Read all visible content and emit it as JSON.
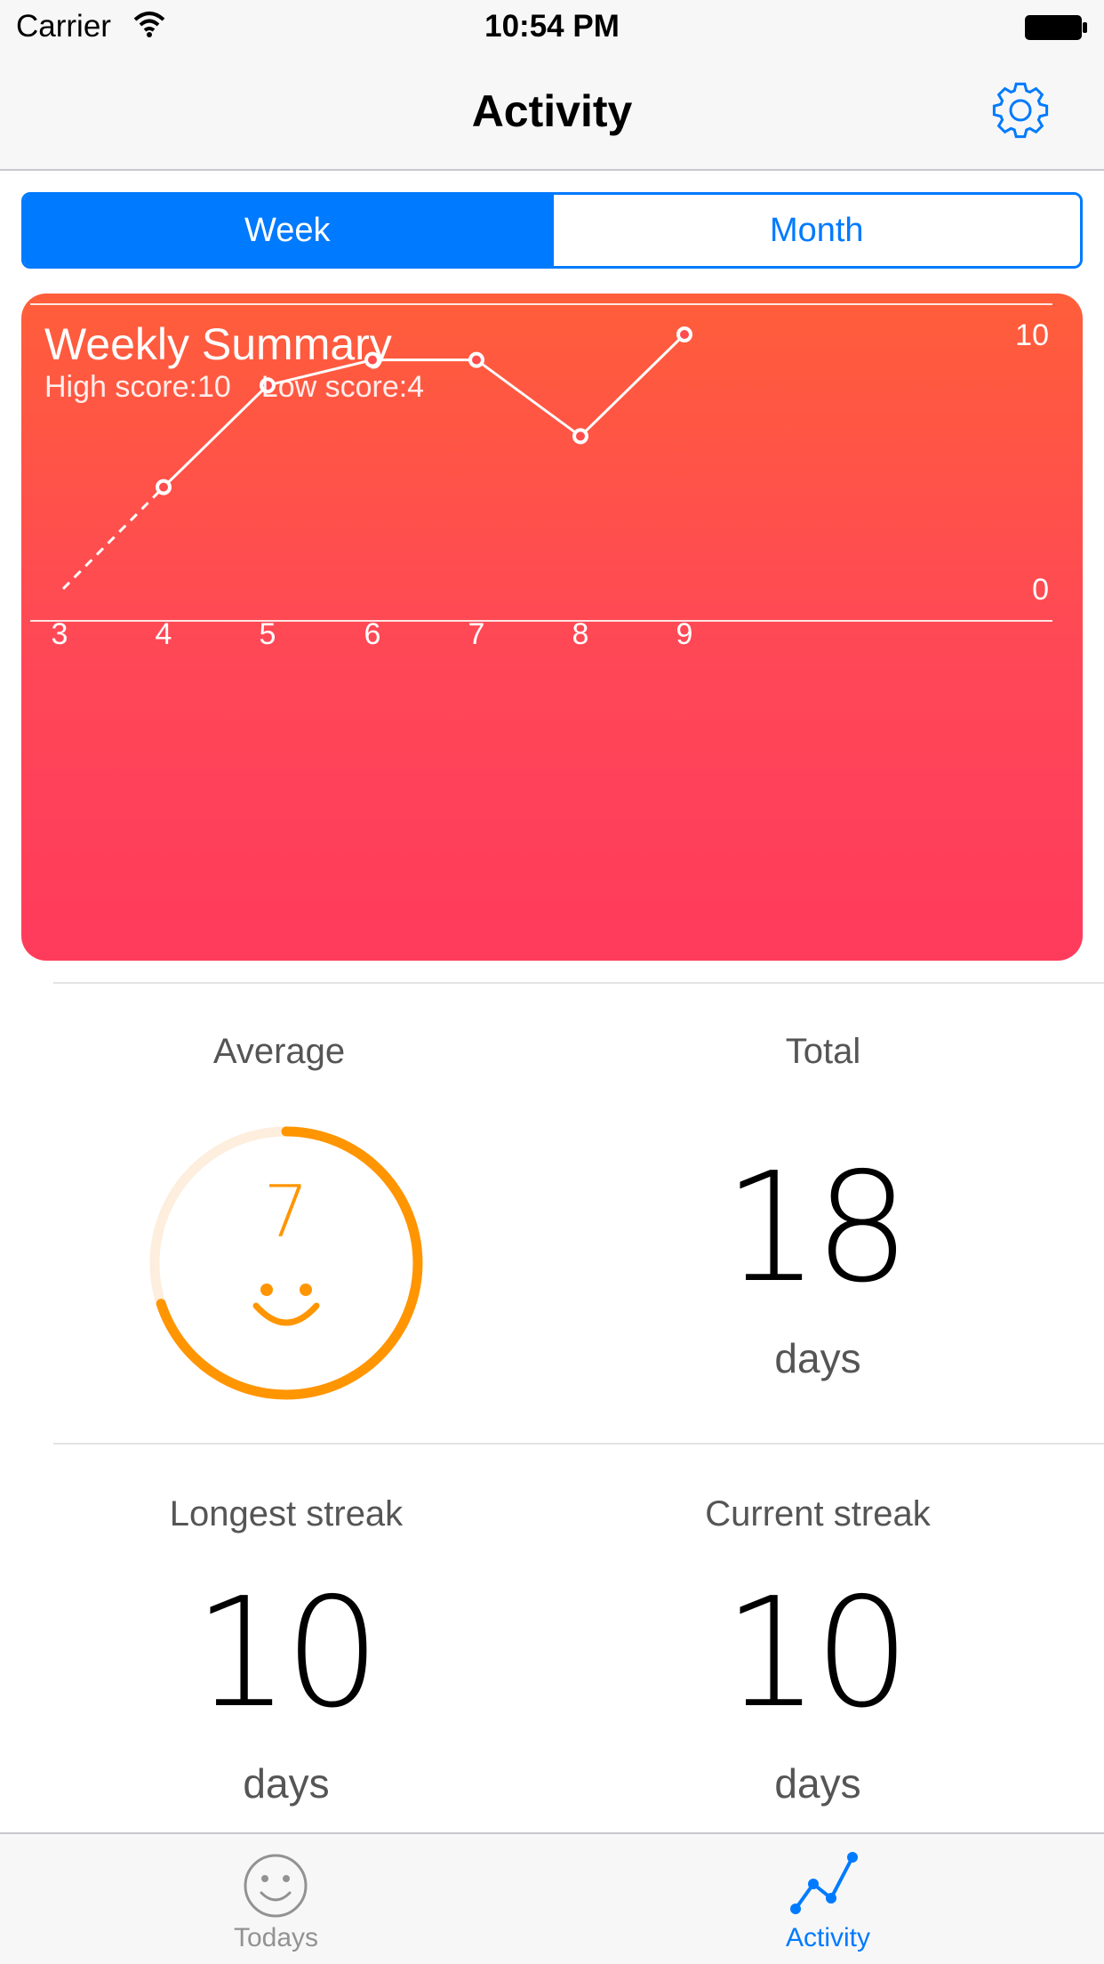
{
  "status_bar": {
    "carrier": "Carrier",
    "time": "10:54 PM"
  },
  "nav": {
    "title": "Activity",
    "settings_icon": "gear-icon"
  },
  "segmented": {
    "options": [
      "Week",
      "Month"
    ],
    "selected": "Week"
  },
  "summary": {
    "title": "Weekly Summary",
    "high": "High score:10",
    "low": "Low score:4"
  },
  "chart_data": {
    "type": "line",
    "x": [
      3,
      4,
      5,
      6,
      7,
      8,
      9
    ],
    "values": [
      null,
      4,
      8,
      9,
      9,
      6,
      10
    ],
    "dashed_segment": {
      "from_x": 3,
      "to_x": 4
    },
    "ylim": [
      0,
      10
    ],
    "y_tick_labels": [
      "10",
      "0"
    ],
    "x_tick_labels": [
      "3",
      "4",
      "5",
      "6",
      "7",
      "8",
      "9"
    ],
    "line_color": "#ffffff"
  },
  "stats": {
    "average": {
      "label": "Average",
      "value": "7",
      "fraction": 0.7,
      "icon": "smiley-icon"
    },
    "total": {
      "label": "Total",
      "value": "18",
      "unit": "days"
    },
    "longest": {
      "label": "Longest streak",
      "value": "10",
      "unit": "days"
    },
    "current": {
      "label": "Current streak",
      "value": "10",
      "unit": "days"
    }
  },
  "tabbar": {
    "tabs": [
      {
        "label": "Todays",
        "icon": "smiley-icon",
        "active": false
      },
      {
        "label": "Activity",
        "icon": "chart-icon",
        "active": true
      }
    ]
  },
  "colors": {
    "accent": "#007aff",
    "ring": "#ff9500",
    "ring_track": "#fdeedd",
    "inactive": "#929292"
  }
}
